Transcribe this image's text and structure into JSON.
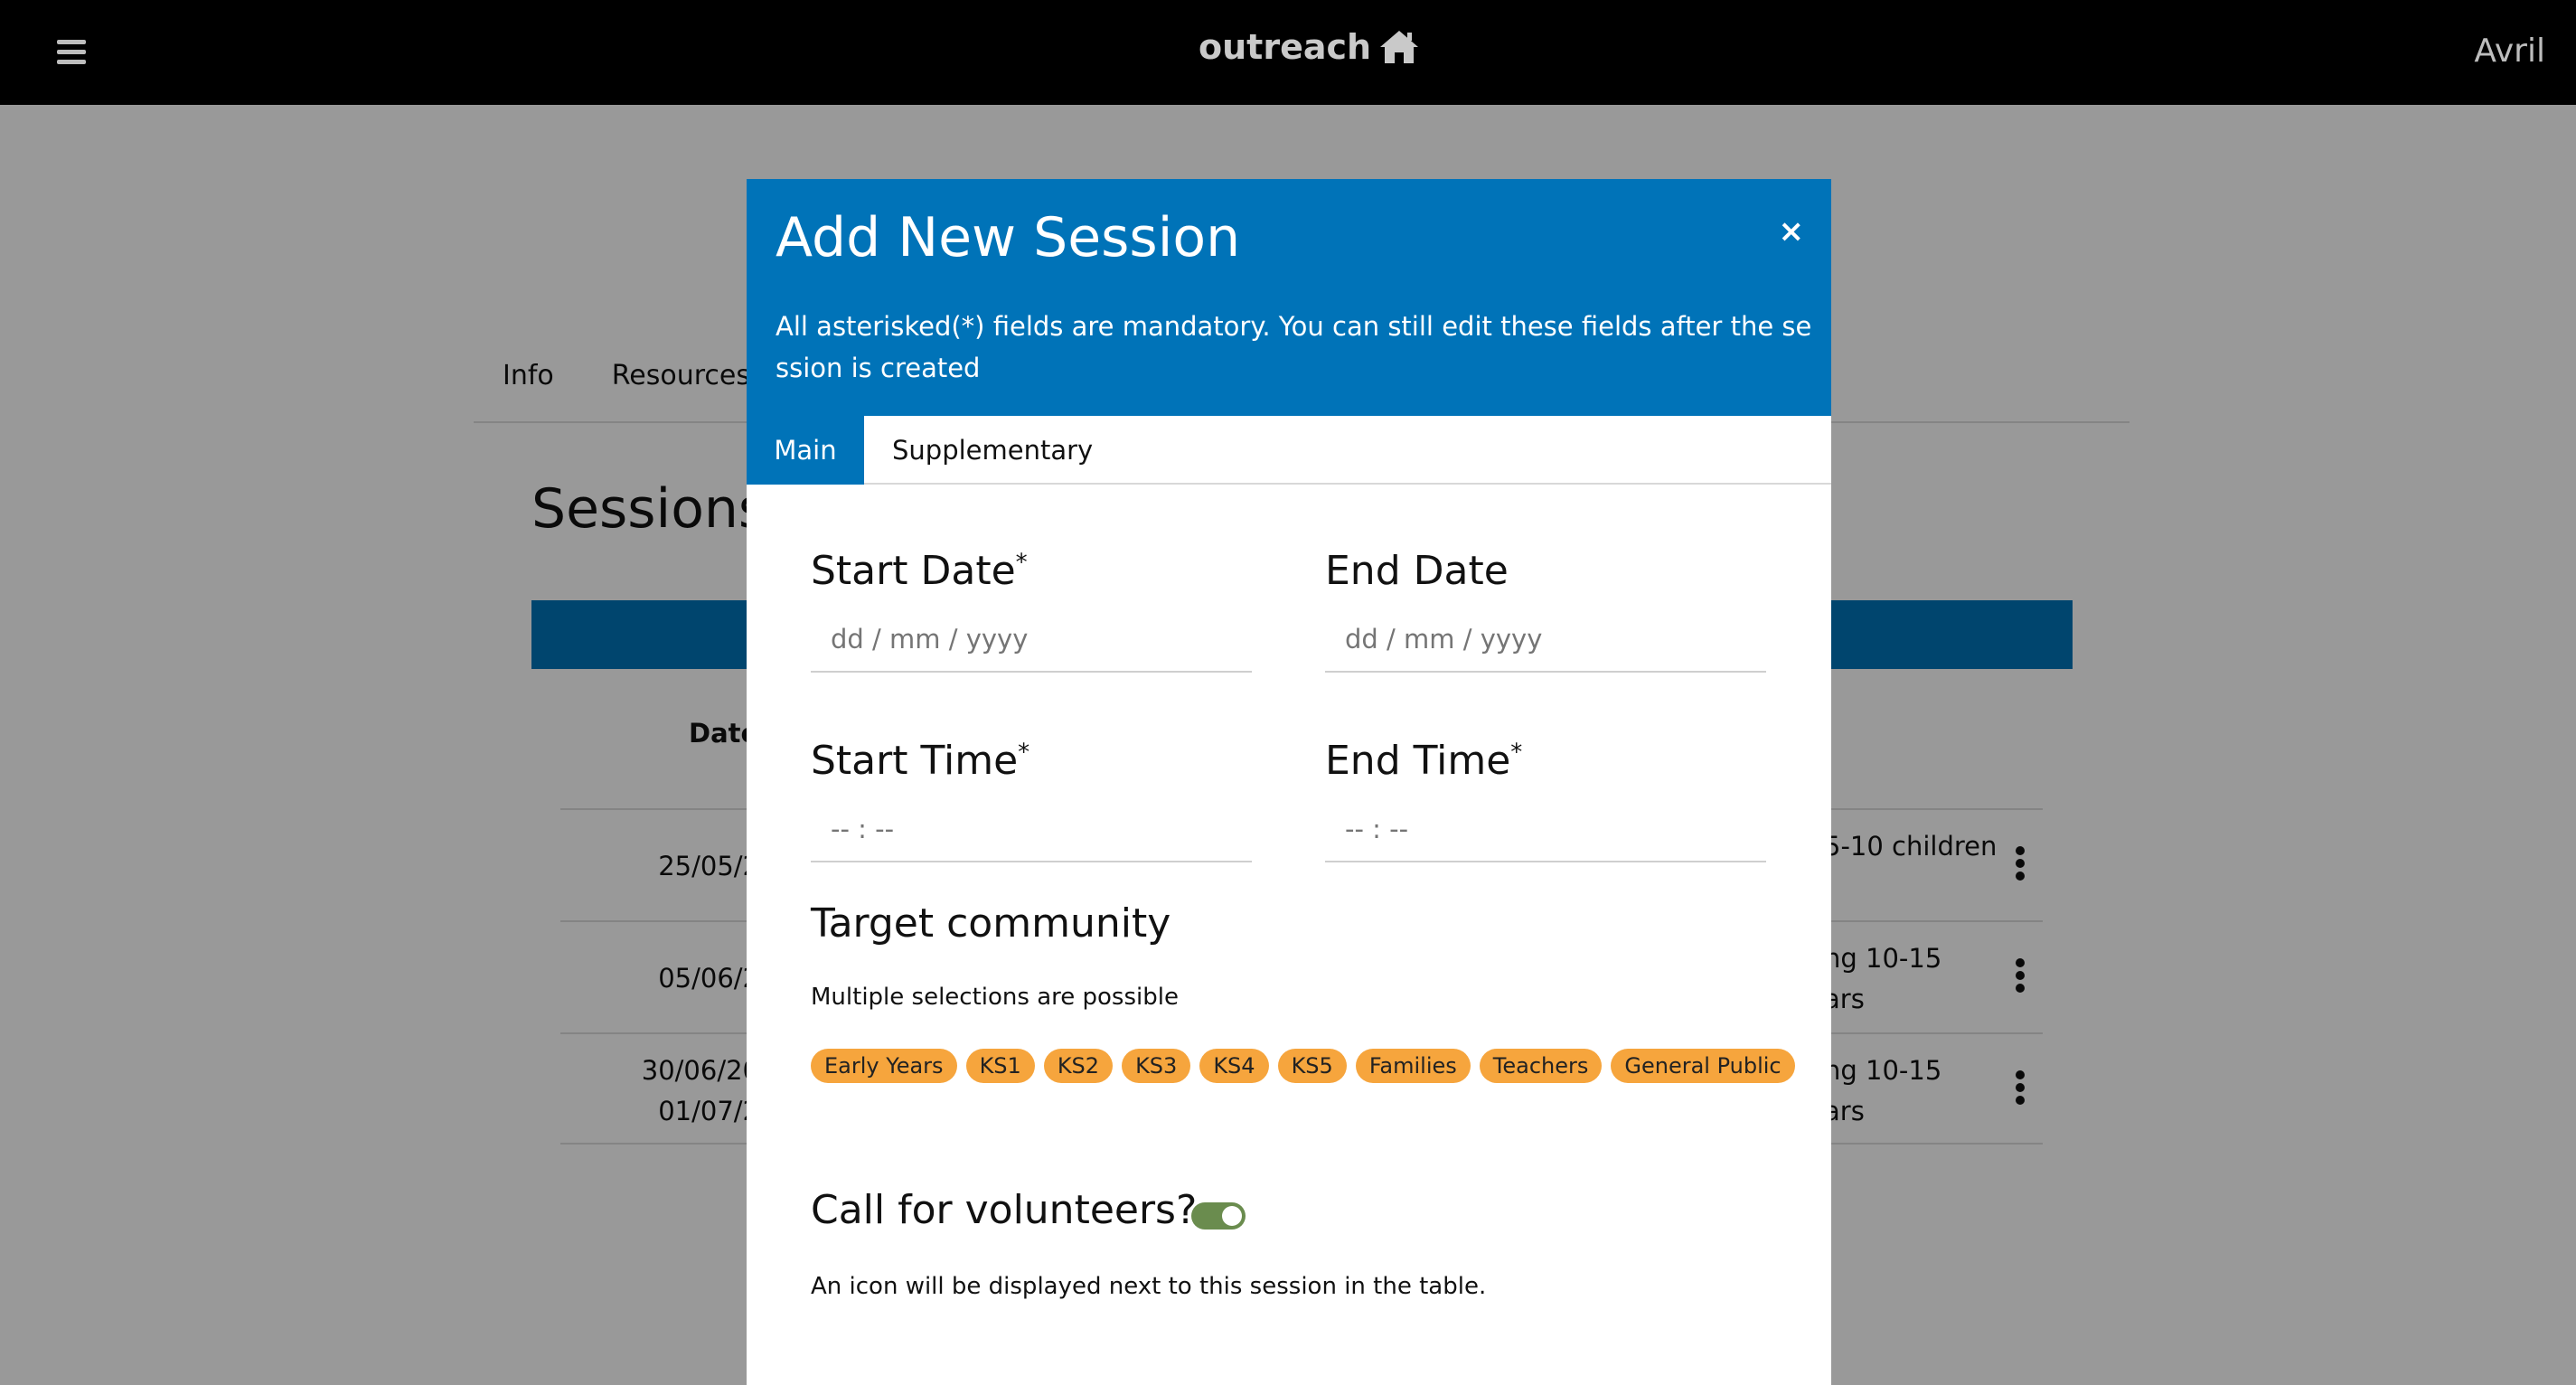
{
  "navbar": {
    "brand": "outreach",
    "brand_icon": "home-icon",
    "menu_icon": "hamburger-icon",
    "user": "Avril"
  },
  "background": {
    "tabs": [
      "Info",
      "Resources"
    ],
    "heading": "Sessions",
    "date_header": "Date",
    "rows": [
      {
        "date_lines": [
          "25/05/2"
        ],
        "community_lines": [
          "5-10 children"
        ]
      },
      {
        "date_lines": [
          "05/06/2"
        ],
        "community_lines": [
          "ng 10-15",
          "ars"
        ]
      },
      {
        "date_lines": [
          "30/06/20",
          "01/07/2"
        ],
        "community_lines": [
          "ng 10-15",
          "ars"
        ]
      }
    ]
  },
  "modal": {
    "title": "Add New Session",
    "close_label": "×",
    "description": "All asterisked(*) fields are mandatory. You can still edit these fields after the session is created",
    "tabs": {
      "main": "Main",
      "supplementary": "Supplementary"
    },
    "fields": {
      "start_date": {
        "label": "Start Date",
        "required": "*",
        "placeholder": "dd / mm / yyyy"
      },
      "end_date": {
        "label": "End Date",
        "placeholder": "dd / mm / yyyy"
      },
      "start_time": {
        "label": "Start Time",
        "required": "*",
        "placeholder": "-- : --"
      },
      "end_time": {
        "label": "End Time",
        "required": "*",
        "placeholder": "-- : --"
      }
    },
    "target_community": {
      "title": "Target community",
      "hint": "Multiple selections are possible",
      "tags": [
        "Early Years",
        "KS1",
        "KS2",
        "KS3",
        "KS4",
        "KS5",
        "Families",
        "Teachers",
        "General Public"
      ]
    },
    "volunteers": {
      "label": "Call for volunteers?",
      "enabled": true,
      "note": "An icon will be displayed next to this session in the table."
    }
  },
  "colors": {
    "primary": "#0073b8",
    "tag": "#f6a53d",
    "toggle_on": "#6a8c4e",
    "navbar": "#000000"
  }
}
